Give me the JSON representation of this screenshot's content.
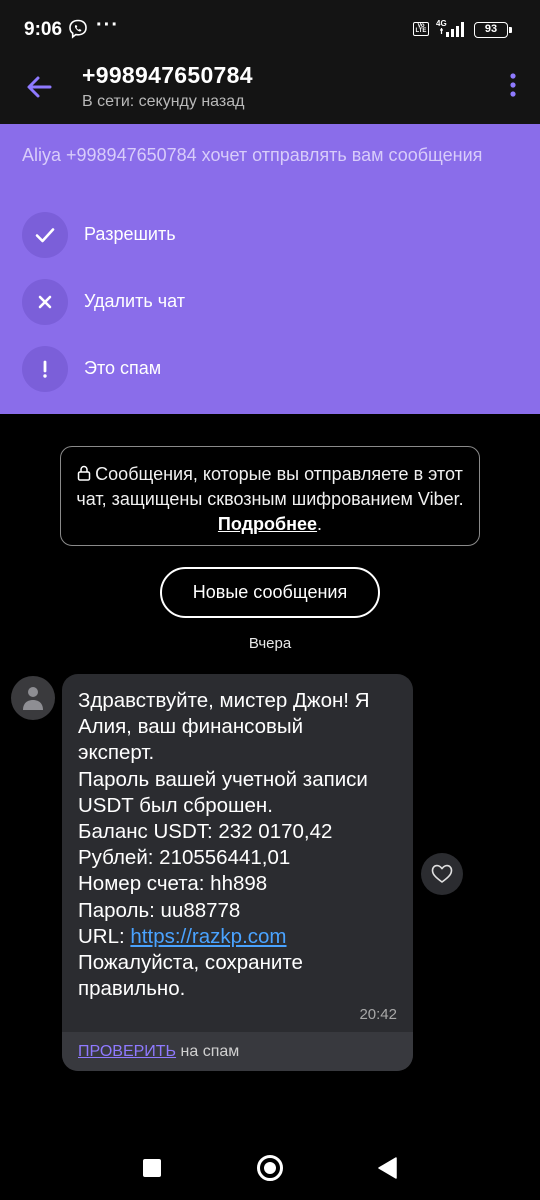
{
  "status_bar": {
    "time": "9:06",
    "dots": "···",
    "network": "4G",
    "volte": "Vo LTE",
    "battery": "93",
    "icons": [
      "viber-icon",
      "volte-icon",
      "signal-icon",
      "battery-icon"
    ]
  },
  "header": {
    "title": "+998947650784",
    "subtitle": "В сети: секунду назад",
    "icons": [
      "back-arrow-icon",
      "more-vertical-icon"
    ],
    "accent_color": "#8a6dea"
  },
  "request_panel": {
    "text": "Aliya +998947650784 хочет отправлять вам сообщения",
    "actions": [
      {
        "label": "Разрешить",
        "icon": "check-icon"
      },
      {
        "label": "Удалить чат",
        "icon": "close-icon"
      },
      {
        "label": "Это спам",
        "icon": "exclamation-icon"
      }
    ]
  },
  "encryption_notice": {
    "text": "Сообщения, которые вы отправляете в этот чат, защищены сквозным шифрованием Viber.",
    "link": "Подробнее",
    "trailing": "."
  },
  "new_messages_button": "Новые сообщения",
  "date_divider": "Вчера",
  "message": {
    "lines": [
      "Здравствуйте, мистер Джон! Я",
      "Алия, ваш финансовый",
      "эксперт.",
      "Пароль вашей учетной записи",
      "USDT был сброшен.",
      "Баланс USDT: 232 0170,42",
      "Рублей: 210556441,01",
      "Номер счета: hh898",
      "Пароль: uu88778"
    ],
    "url_label": "URL: ",
    "url": "https://razkp.com",
    "closing_lines": [
      "Пожалуйста, сохраните",
      "правильно."
    ],
    "time": "20:42",
    "spam_check_link": "ПРОВЕРИТЬ",
    "spam_check_suffix": " на спам"
  },
  "nav": {
    "icons": [
      "recents-square-icon",
      "home-circle-icon",
      "back-triangle-icon"
    ]
  }
}
